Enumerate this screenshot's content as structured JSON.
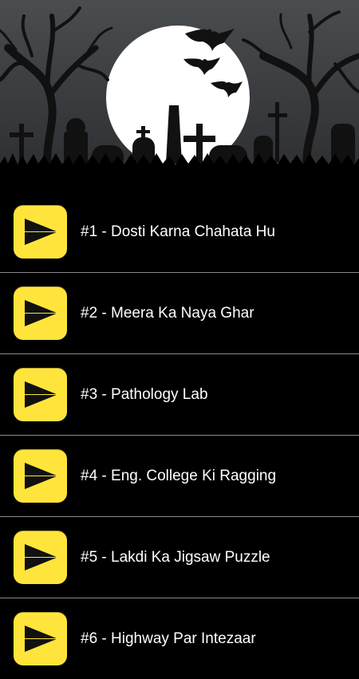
{
  "colors": {
    "background": "#000000",
    "button": "#ffe53b",
    "text": "#ffffff",
    "divider": "#8a8a8a"
  },
  "banner": {
    "icon": "graveyard-halloween-illustration"
  },
  "stories": [
    {
      "label": "#1 - Dosti Karna Chahata Hu",
      "icon": "play-icon"
    },
    {
      "label": "#2 - Meera Ka Naya Ghar",
      "icon": "play-icon"
    },
    {
      "label": "#3 - Pathology Lab",
      "icon": "play-icon"
    },
    {
      "label": "#4 - Eng. College Ki Ragging",
      "icon": "play-icon"
    },
    {
      "label": "#5 - Lakdi Ka Jigsaw Puzzle",
      "icon": "play-icon"
    },
    {
      "label": "#6 - Highway Par Intezaar",
      "icon": "play-icon"
    }
  ]
}
